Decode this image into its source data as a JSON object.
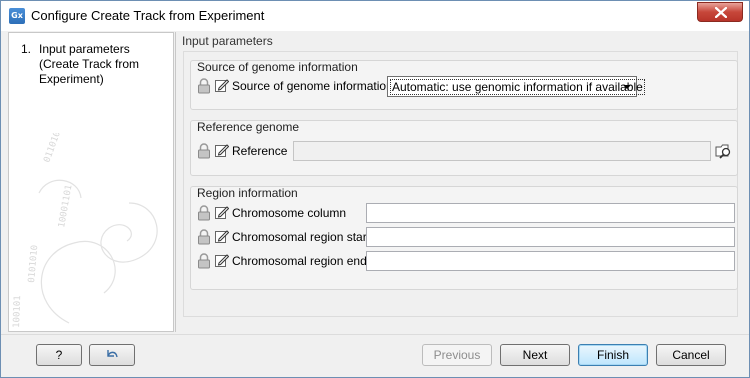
{
  "window": {
    "title": "Configure Create Track from Experiment",
    "app_icon_text": "Gx"
  },
  "sidebar": {
    "steps": [
      {
        "number": "1.",
        "label": "Input parameters (Create Track from Experiment)"
      }
    ]
  },
  "main": {
    "title": "Input parameters",
    "groups": {
      "source": {
        "title": "Source of genome information",
        "label": "Source of genome information",
        "selected": "Automatic: use genomic information if available"
      },
      "reference": {
        "title": "Reference genome",
        "label": "Reference",
        "value": ""
      },
      "region": {
        "title": "Region information",
        "fields": [
          {
            "label": "Chromosome column",
            "value": ""
          },
          {
            "label": "Chromosomal region start",
            "value": ""
          },
          {
            "label": "Chromosomal region end",
            "value": ""
          }
        ]
      }
    }
  },
  "footer": {
    "help_label": "?",
    "previous_label": "Previous",
    "next_label": "Next",
    "finish_label": "Finish",
    "cancel_label": "Cancel"
  }
}
